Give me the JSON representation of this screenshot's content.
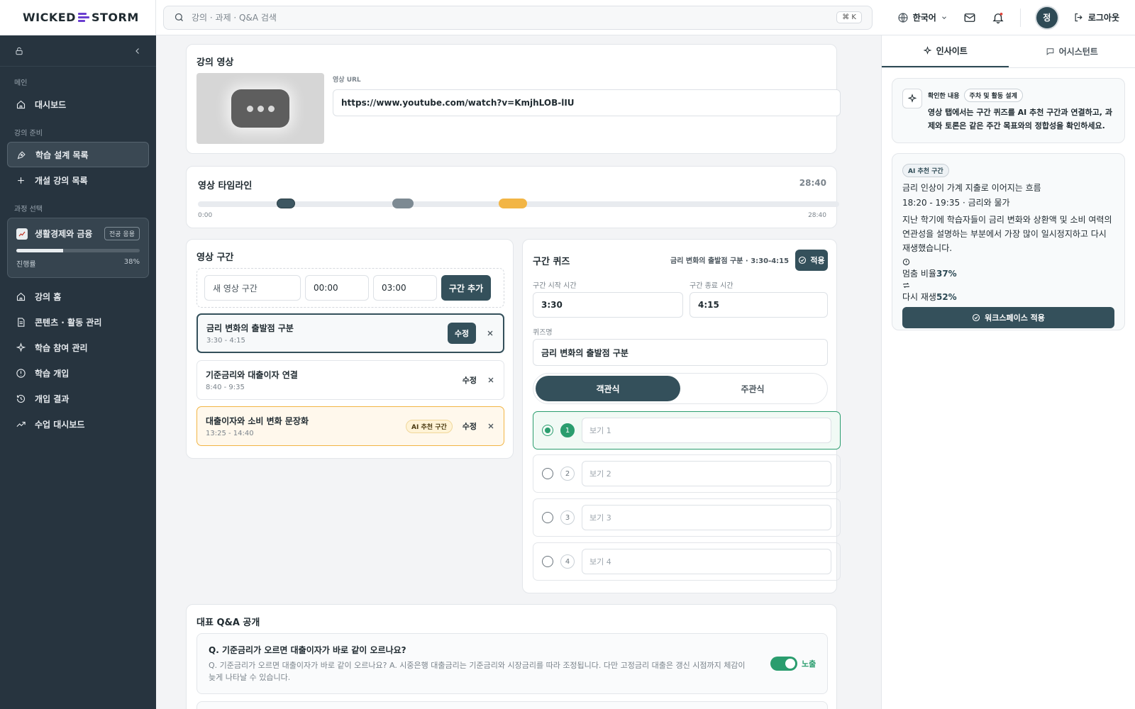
{
  "brand": {
    "left": "WICKED",
    "right": "STORM",
    "accent": "#6a3fd0"
  },
  "topbar": {
    "search_placeholder": "강의 · 과제 · Q&A 검색",
    "shortcut": "⌘ K",
    "language": "한국어",
    "avatar_initial": "정",
    "logout": "로그아웃"
  },
  "sidebar": {
    "sections": {
      "main": "메인",
      "prep": "강의 준비",
      "course": "과정 선택"
    },
    "items": {
      "dashboard": "대시보드",
      "design_list": "학습 설계 목록",
      "open_list": "개설 강의 목록",
      "course_home": "강의 홈",
      "content": "콘텐츠 · 활동 관리",
      "participation": "학습 참여 관리",
      "intervention": "학습 개입",
      "intervention_result": "개입 결과",
      "class_dashboard": "수업 대시보드"
    },
    "course": {
      "name": "생활경제와 금융",
      "badge": "전공 응용",
      "progress_label": "진행률",
      "progress_text": "38%",
      "progress": 0.38
    }
  },
  "video": {
    "title": "강의 영상",
    "url_label": "영상 URL",
    "url": "https://www.youtube.com/watch?v=KmjhLOB-lIU"
  },
  "timeline": {
    "title": "영상 타임라인",
    "duration": "28:40",
    "start": "0:00",
    "end": "28:40",
    "colors": [
      "#3d5661",
      "#7d8a93",
      "#f2b545"
    ]
  },
  "segments": {
    "title": "영상 구간",
    "new_name_placeholder": "새 영상 구간",
    "new_start": "00:00",
    "new_end": "03:00",
    "add_button": "구간 추가",
    "edit": "수정",
    "ai_badge": "AI 추천 구간",
    "items": [
      {
        "name": "금리 변화의 출발점 구분",
        "range": "3:30 - 4:15"
      },
      {
        "name": "기준금리와 대출이자 연결",
        "range": "8:40 - 9:35"
      },
      {
        "name": "대출이자와 소비 변화 문장화",
        "range": "13:25 - 14:40"
      }
    ]
  },
  "quiz": {
    "title": "구간 퀴즈",
    "context": "금리 변화의 출발점 구분 · 3:30-4:15",
    "apply": "적용",
    "start_label": "구간 시작 시간",
    "start": "3:30",
    "end_label": "구간 종료 시간",
    "end": "4:15",
    "name_label": "퀴즈명",
    "name": "금리 변화의 출발점 구분",
    "type_objective": "객관식",
    "type_subjective": "주관식",
    "options": [
      {
        "num": "1",
        "placeholder": "보기 1"
      },
      {
        "num": "2",
        "placeholder": "보기 2"
      },
      {
        "num": "3",
        "placeholder": "보기 3"
      },
      {
        "num": "4",
        "placeholder": "보기 4"
      }
    ]
  },
  "qa": {
    "title": "대표 Q&A 공개",
    "question": "Q. 기준금리가 오르면 대출이자가 바로 같이 오르나요?",
    "answer": "Q. 기준금리가 오르면 대출이자가 바로 같이 오르나요? A. 시중은행 대출금리는 기준금리와 시장금리를 따라 조정됩니다. 다만 고정금리 대출은 갱신 시점까지 체감이 늦게 나타날 수 있습니다.",
    "visible_label": "노출"
  },
  "right_panel": {
    "tab_insight": "인사이트",
    "tab_assistant": "어시스턴트",
    "confirm_label": "확인한 내용",
    "confirm_pill": "주차 및 활동 설계",
    "confirm_text": "영상 탭에서는 구간 퀴즈를 AI 추천 구간과 연결하고, 과제와 토론은 같은 주간 목표와의 정합성을 확인하세요.",
    "ai": {
      "badge": "AI 추천 구간",
      "title": "금리 인상이 가계 지출로 이어지는 흐름",
      "range": "18:20 - 19:35 · 금리와 물가",
      "desc": "지난 학기에 학습자들이 금리 변화와 상환액 및 소비 여력의 연관성을 설명하는 부분에서 가장 많이 일시정지하고 다시 재생했습니다.",
      "pause_label": "멈춤 비율",
      "pause_value": "37%",
      "replay_label": "다시 재생",
      "replay_value": "52%",
      "apply_button": "워크스페이스 적용"
    }
  }
}
